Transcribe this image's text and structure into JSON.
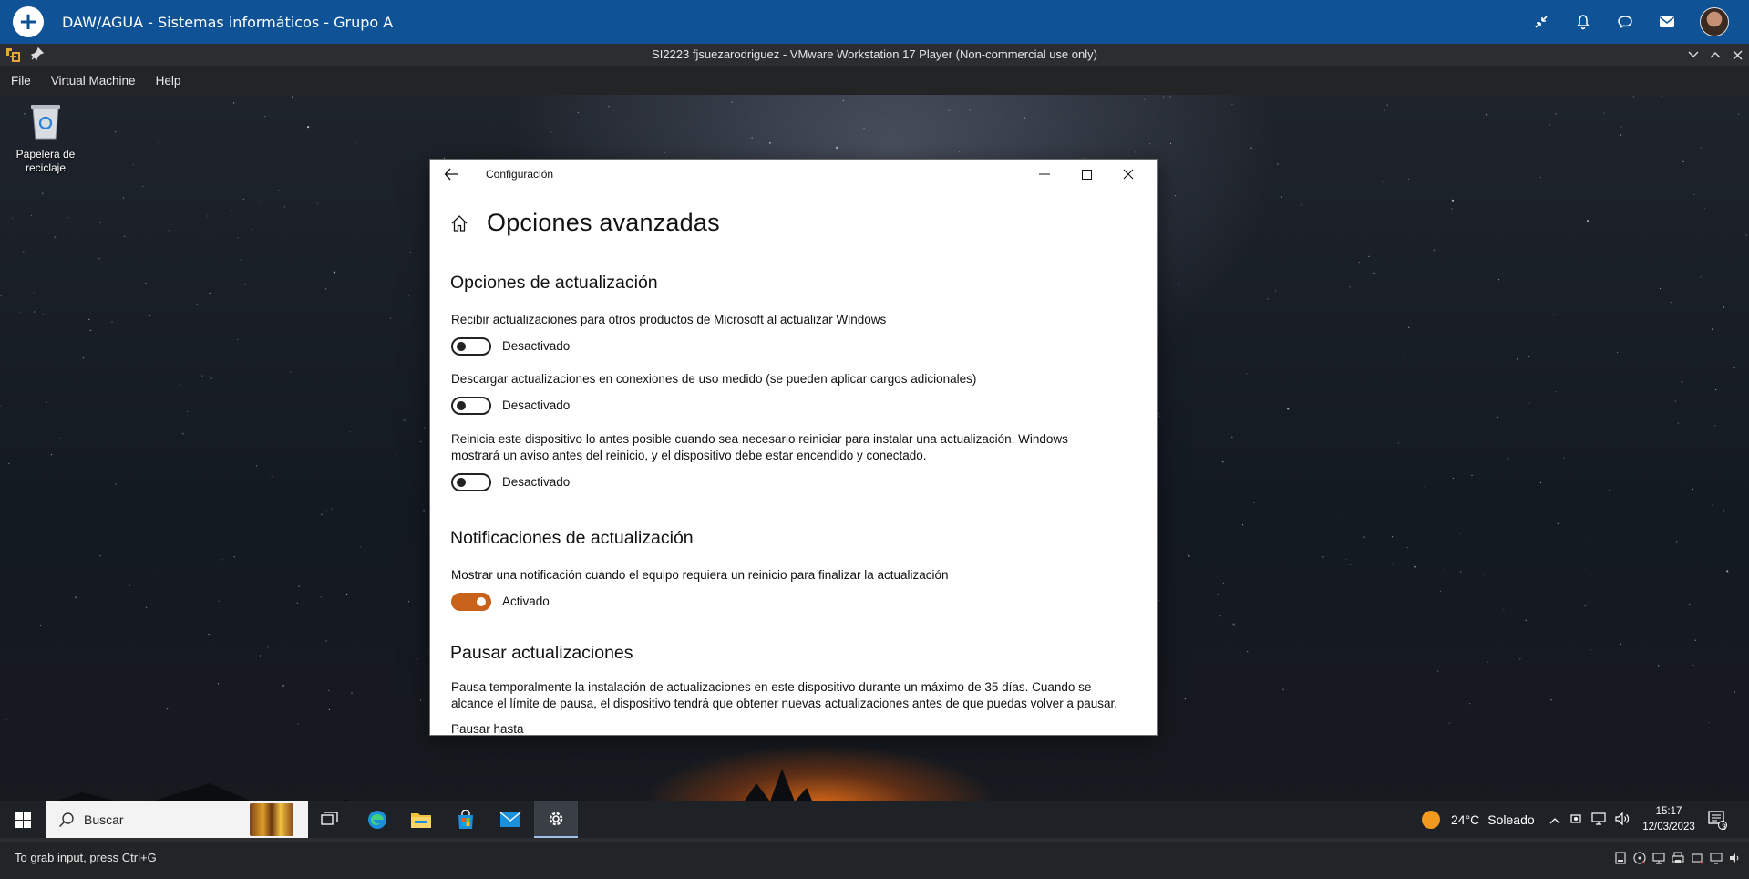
{
  "app_bar": {
    "title": "DAW/AGUA - Sistemas informáticos - Grupo A",
    "icons": [
      "add-icon",
      "collapse-icon",
      "bell-icon",
      "chat-icon",
      "mail-icon",
      "avatar"
    ]
  },
  "vmware": {
    "title": "SI2223 fjsuezarodriguez - VMware Workstation 17 Player (Non-commercial use only)",
    "menu": [
      "File",
      "Virtual Machine",
      "Help"
    ],
    "status_hint": "To grab input, press Ctrl+G"
  },
  "desktop": {
    "recycle_bin_label": "Papelera de reciclaje"
  },
  "settings": {
    "window_title": "Configuración",
    "page_title": "Opciones avanzadas",
    "section1": {
      "heading": "Opciones de actualización",
      "option1_text": "Recibir actualizaciones para otros productos de Microsoft al actualizar Windows",
      "option1_state": "Desactivado",
      "option2_text": "Descargar actualizaciones en conexiones de uso medido (se pueden aplicar cargos adicionales)",
      "option2_state": "Desactivado",
      "option3_text": "Reinicia este dispositivo lo antes posible cuando sea necesario reiniciar para instalar una actualización. Windows mostrará un aviso antes del reinicio, y el dispositivo debe estar encendido y conectado.",
      "option3_state": "Desactivado"
    },
    "section2": {
      "heading": "Notificaciones de actualización",
      "option1_text": "Mostrar una notificación cuando el equipo requiera un reinicio para finalizar la actualización",
      "option1_state": "Activado"
    },
    "section3": {
      "heading": "Pausar actualizaciones",
      "description": "Pausa temporalmente la instalación de actualizaciones en este dispositivo durante un máximo de 35 días. Cuando se alcance el límite de pausa, el dispositivo tendrá que obtener nuevas actualizaciones antes de que puedas volver a pausar.",
      "pause_until_label": "Pausar hasta"
    },
    "accent_color": "#c8621a"
  },
  "taskbar": {
    "search_placeholder": "Buscar",
    "weather_temp": "24°C",
    "weather_desc": "Soleado",
    "time": "15:17",
    "date": "12/03/2023",
    "notification_count": "3"
  },
  "colors": {
    "app_bar": "#0f5296",
    "vm_chrome": "#222426",
    "taskbar": "#1e2226"
  }
}
